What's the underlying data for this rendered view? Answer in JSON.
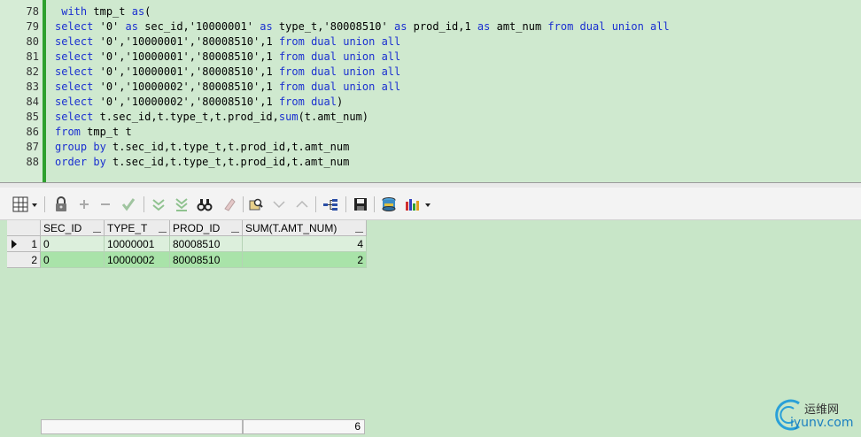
{
  "editor": {
    "lines": [
      {
        "n": "78",
        "code": " with tmp_t as("
      },
      {
        "n": "79",
        "code": "select '0' as sec_id,'10000001' as type_t,'80008510' as prod_id,1 as amt_num from dual union all"
      },
      {
        "n": "80",
        "code": "select '0','10000001','80008510',1 from dual union all"
      },
      {
        "n": "81",
        "code": "select '0','10000001','80008510',1 from dual union all"
      },
      {
        "n": "82",
        "code": "select '0','10000001','80008510',1 from dual union all"
      },
      {
        "n": "83",
        "code": "select '0','10000002','80008510',1 from dual union all"
      },
      {
        "n": "84",
        "code": "select '0','10000002','80008510',1 from dual)"
      },
      {
        "n": "85",
        "code": "select t.sec_id,t.type_t,t.prod_id,sum(t.amt_num)"
      },
      {
        "n": "86",
        "code": "from tmp_t t"
      },
      {
        "n": "87",
        "code": "group by t.sec_id,t.type_t,t.prod_id,t.amt_num"
      },
      {
        "n": "88",
        "code": "order by t.sec_id,t.type_t,t.prod_id,t.amt_num"
      }
    ]
  },
  "toolbar": {
    "icons": [
      "grid-layout-icon",
      "dropdown-arrow-icon",
      "lock-icon",
      "add-record-icon",
      "delete-record-icon",
      "post-changes-icon",
      "fetch-next-icon",
      "fetch-last-icon",
      "find-icon",
      "clear-icon",
      "query-by-example-icon",
      "filter-down-icon",
      "filter-up-icon",
      "tree-view-icon",
      "save-icon",
      "export-icon",
      "chart-icon"
    ]
  },
  "grid": {
    "columns": [
      "SEC_ID",
      "TYPE_T",
      "PROD_ID",
      "SUM(T.AMT_NUM)"
    ],
    "rows": [
      {
        "index": "1",
        "cells": [
          "0",
          "10000001",
          "80008510",
          "4"
        ]
      },
      {
        "index": "2",
        "cells": [
          "0",
          "10000002",
          "80008510",
          "2"
        ]
      }
    ],
    "footer_total": "6"
  },
  "watermark": {
    "title": "运维网",
    "url": "iyunv.com"
  }
}
